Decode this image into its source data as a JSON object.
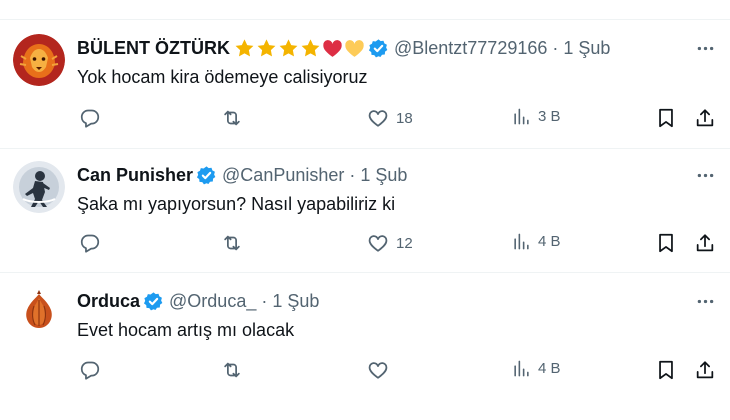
{
  "replies": [
    {
      "name": "BÜLENT ÖZTÜRK",
      "handle": "@Blentzt77729166",
      "time": "1 Şub",
      "text": "Yok hocam kira ödemeye calisiyoruz",
      "likes": "18",
      "views": "3 B",
      "badges": [
        "star-icon",
        "star-icon",
        "star-icon",
        "star-icon",
        "red-heart-icon",
        "yellow-heart-icon"
      ]
    },
    {
      "name": "Can Punisher",
      "handle": "@CanPunisher",
      "time": "1 Şub",
      "text": "Şaka mı yapıyorsun? Nasıl yapabiliriz ki",
      "likes": "12",
      "views": "4 B"
    },
    {
      "name": "Orduca",
      "handle": "@Orduca_",
      "time": "1 Şub",
      "text": "Evet hocam artış mı olacak",
      "likes": "",
      "views": "4 B"
    }
  ],
  "colors": {
    "text": "#0f1419",
    "secondary": "#536471",
    "verified": "#1d9bf0",
    "divider": "#eff3f4"
  },
  "icons": [
    "reply-icon",
    "retweet-icon",
    "like-icon",
    "views-icon",
    "bookmark-icon",
    "share-icon",
    "more-icon",
    "verified-badge-icon"
  ]
}
